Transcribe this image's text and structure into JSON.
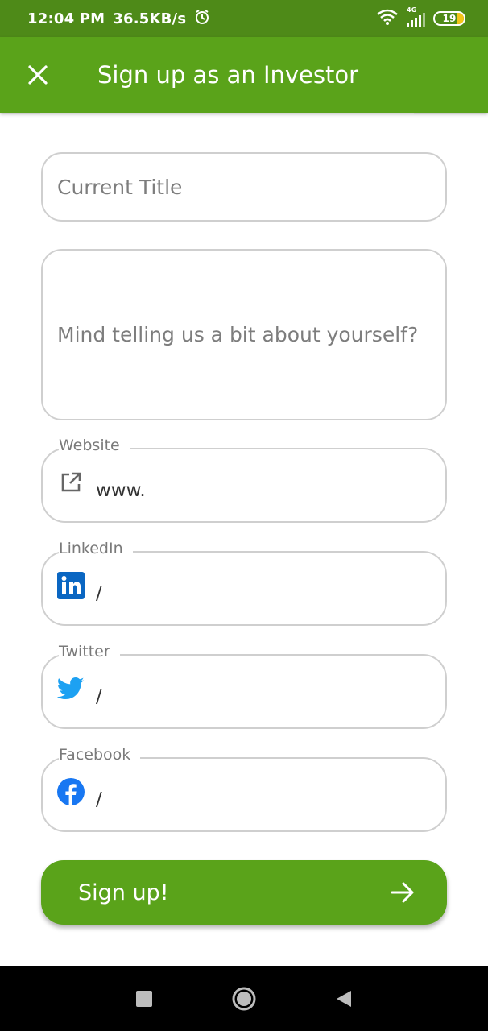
{
  "status_bar": {
    "time": "12:04 PM",
    "speed": "36.5KB/s",
    "network": "4G",
    "battery": "19"
  },
  "app_bar": {
    "title": "Sign up as an Investor",
    "close_icon": "close-icon"
  },
  "form": {
    "current_title": {
      "placeholder": "Current Title"
    },
    "about": {
      "placeholder": "Mind telling us a bit about yourself?"
    },
    "website": {
      "label": "Website",
      "value": "www.",
      "icon": "external-link-icon"
    },
    "linkedin": {
      "label": "LinkedIn",
      "value": "/",
      "icon": "linkedin-icon"
    },
    "twitter": {
      "label": "Twitter",
      "value": "/",
      "icon": "twitter-icon"
    },
    "facebook": {
      "label": "Facebook",
      "value": "/",
      "icon": "facebook-icon"
    }
  },
  "signup_button": {
    "label": "Sign up!",
    "icon": "arrow-right-icon"
  },
  "colors": {
    "status_bar": "#4e8a18",
    "primary": "#5aa31a",
    "linkedin": "#0a66c2",
    "twitter": "#1da1f2",
    "facebook": "#1877f2"
  }
}
